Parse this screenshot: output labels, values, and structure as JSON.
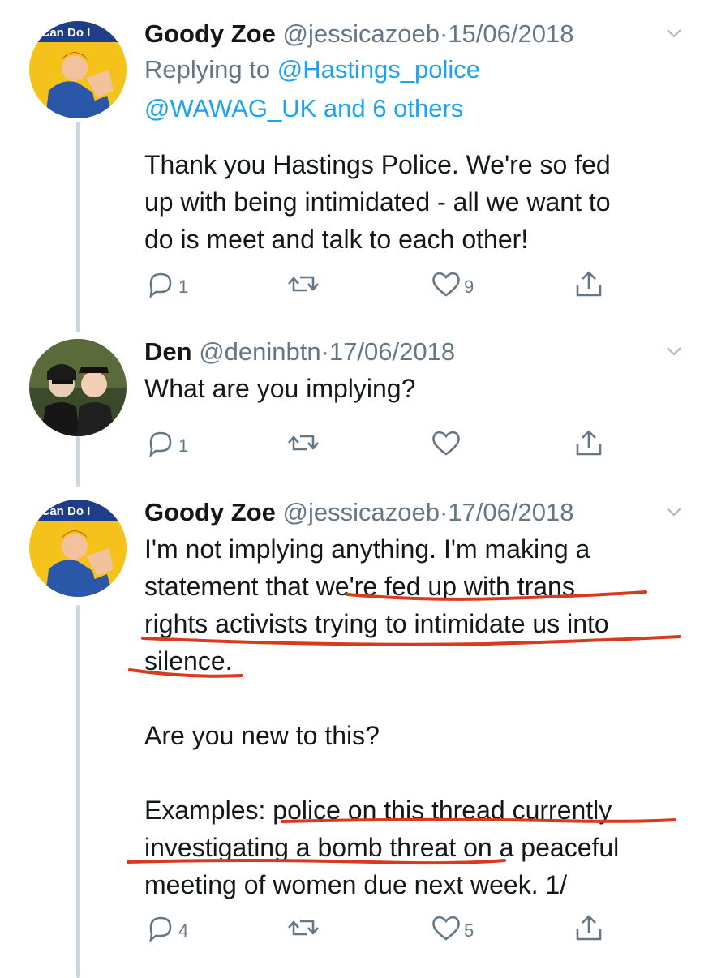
{
  "tweets": [
    {
      "name": "Goody Zoe",
      "handle": "@jessicazoeb",
      "separator": "·",
      "date": "15/06/2018",
      "replying_prefix": "Replying to",
      "replying_line1": "@Hastings_police",
      "replying_line2": "@WAWAG_UK and 6 others",
      "text_lines": [
        "Thank you Hastings Police. We're so fed",
        "up with being intimidated - all we want to",
        "do is meet and talk to each other!"
      ],
      "reply_count": "1",
      "retweet_count": "",
      "like_count": "9",
      "avatar_caption": "e Can Do I"
    },
    {
      "name": "Den",
      "handle": "@deninbtn",
      "separator": "·",
      "date": "17/06/2018",
      "text_lines": [
        "What are you implying?"
      ],
      "reply_count": "1",
      "retweet_count": "",
      "like_count": ""
    },
    {
      "name": "Goody Zoe",
      "handle": "@jessicazoeb",
      "separator": "·",
      "date": "17/06/2018",
      "text_lines": [
        "I'm not implying anything. I'm making a",
        "statement that we're fed up with trans",
        "rights activists trying to intimidate us into",
        "silence.",
        "",
        "Are you new to this?",
        "",
        "Examples: police on this thread currently",
        "investigating a bomb threat on a peaceful",
        "meeting of women due next week. 1/"
      ],
      "reply_count": "4",
      "retweet_count": "",
      "like_count": "5",
      "avatar_caption": "e Can Do I"
    }
  ],
  "icons": {
    "reply": "reply-icon",
    "retweet": "retweet-icon",
    "like": "heart-icon",
    "share": "share-icon",
    "menu": "chevron-down-icon"
  },
  "colors": {
    "text": "#14171a",
    "secondary": "#657786",
    "link": "#1da1f2",
    "thread_line": "#ccd6dd",
    "annotation": "#d93a1e"
  }
}
